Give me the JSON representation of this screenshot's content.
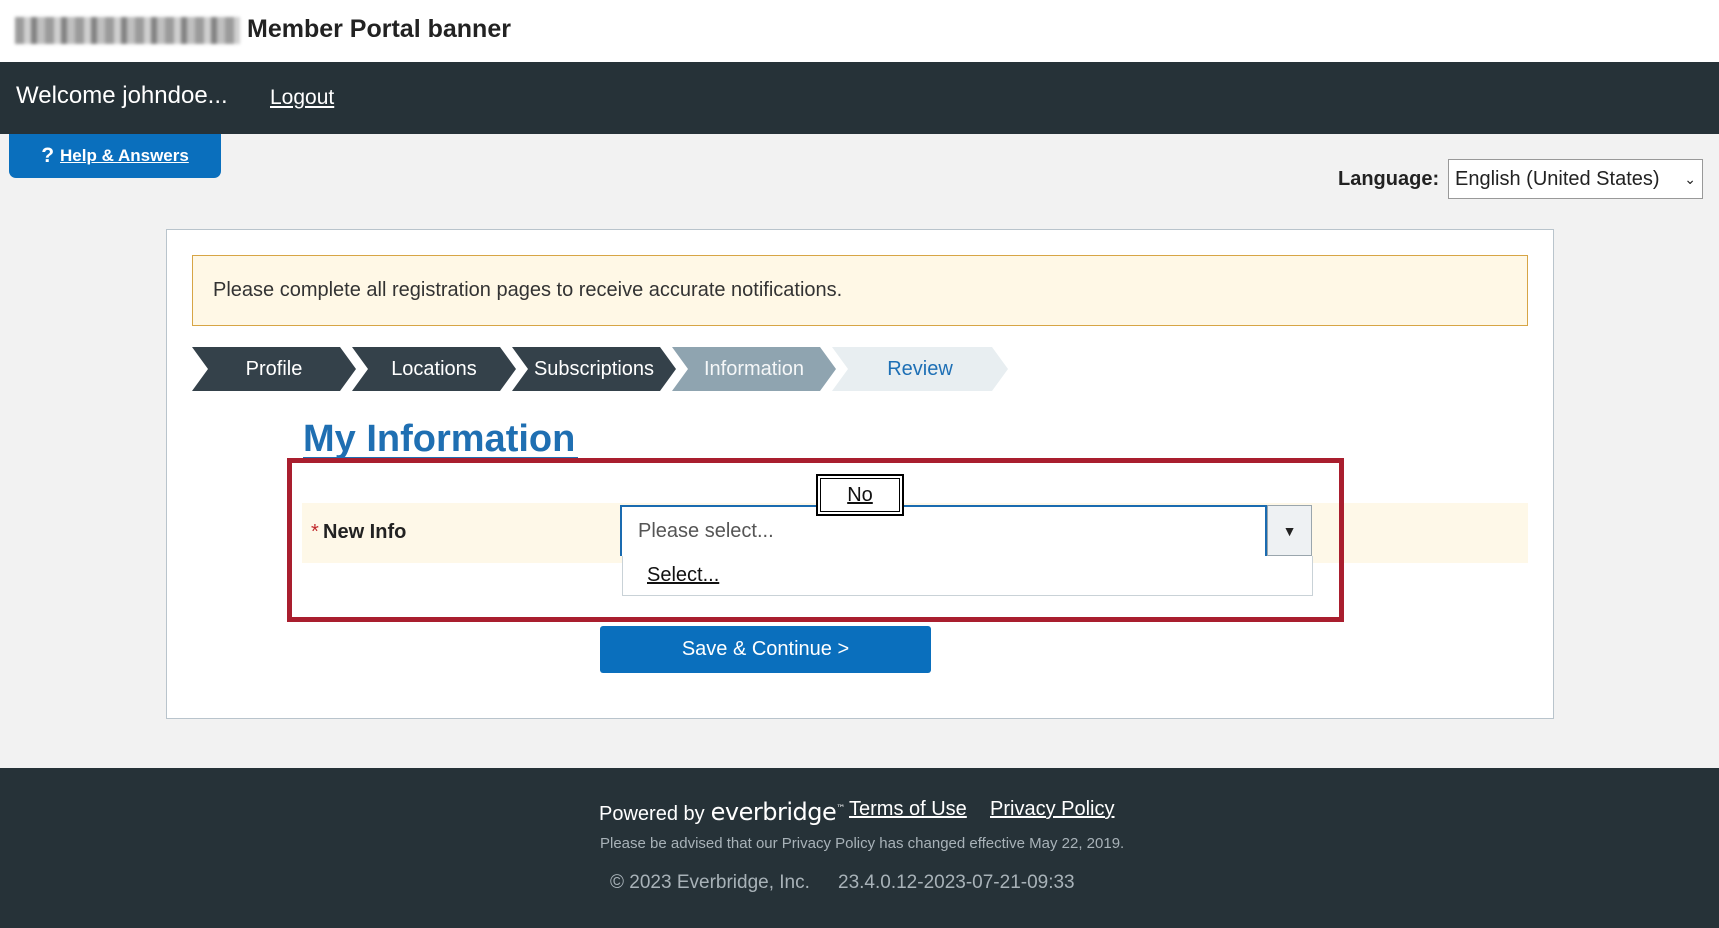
{
  "banner": {
    "logo_name": "member-portal-logo",
    "title": "Member Portal banner"
  },
  "header": {
    "welcome": "Welcome johndoe...",
    "logout": "Logout"
  },
  "help": {
    "icon": "question-mark-icon",
    "icon_glyph": "?",
    "label": "Help & Answers"
  },
  "language": {
    "label": "Language:",
    "selected": "English (United States)",
    "chevron": "⌄"
  },
  "notice": {
    "text": "Please complete all registration pages to receive accurate notifications."
  },
  "steps": [
    {
      "label": "Profile",
      "state": "complete"
    },
    {
      "label": "Locations",
      "state": "complete"
    },
    {
      "label": "Subscriptions",
      "state": "complete"
    },
    {
      "label": "Information",
      "state": "current"
    },
    {
      "label": "Review",
      "state": "upcoming"
    }
  ],
  "main": {
    "title": "My Information",
    "field": {
      "required_mark": "*",
      "label": "New Info",
      "placeholder": "Please select...",
      "caret_glyph": "▼",
      "options": [
        "Select..."
      ]
    },
    "no_option": "No",
    "save_label": "Save & Continue >"
  },
  "footer": {
    "powered_by": "Powered by",
    "brand": "everbridge",
    "brand_tm": "™",
    "terms": "Terms of Use",
    "privacy": "Privacy Policy",
    "advised": "Please be advised that our Privacy Policy has changed effective May 22, 2019.",
    "copyright": "©  2023 Everbridge, Inc.",
    "version": "23.4.0.12-2023-07-21-09:33"
  },
  "colors": {
    "header_bg": "#263238",
    "primary_blue": "#0a6fbd",
    "highlight_red": "#a91e2e",
    "notice_bg": "#fff8e6"
  }
}
